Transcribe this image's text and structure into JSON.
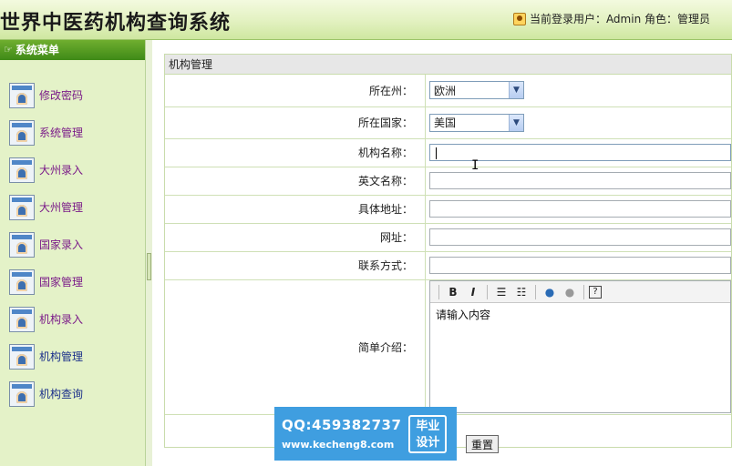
{
  "header": {
    "title": "世界中医药机构查询系统",
    "user_info": "当前登录用户：Admin 角色：管理员"
  },
  "sidebar": {
    "heading": "系统菜单",
    "items": [
      {
        "label": "修改密码"
      },
      {
        "label": "系统管理"
      },
      {
        "label": "大州录入"
      },
      {
        "label": "大州管理"
      },
      {
        "label": "国家录入"
      },
      {
        "label": "国家管理"
      },
      {
        "label": "机构录入"
      },
      {
        "label": "机构管理"
      },
      {
        "label": "机构查询"
      }
    ]
  },
  "panel": {
    "title": "机构管理",
    "continent_label": "所在州：",
    "continent_value": "欧洲",
    "country_label": "所在国家：",
    "country_value": "美国",
    "name_label": "机构名称：",
    "english_label": "英文名称：",
    "address_label": "具体地址：",
    "website_label": "网址：",
    "contact_label": "联系方式：",
    "intro_label": "简单介绍：",
    "intro_placeholder": "请输入内容",
    "toolbar": {
      "bold": "B",
      "italic": "I"
    },
    "reset_label": "重置"
  },
  "watermark": {
    "qq": "QQ:459382737",
    "url": "www.kecheng8.com",
    "badge": "毕业设计"
  }
}
